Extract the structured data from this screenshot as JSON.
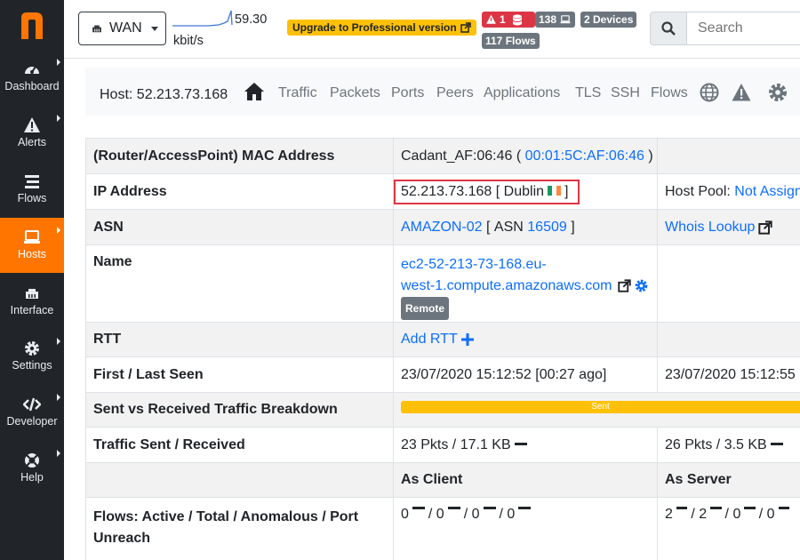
{
  "sidebar": {
    "items": [
      {
        "label": "Dashboard",
        "icon": "gauge-icon"
      },
      {
        "label": "Alerts",
        "icon": "warning-icon"
      },
      {
        "label": "Flows",
        "icon": "stream-icon"
      },
      {
        "label": "Hosts",
        "icon": "laptop-icon",
        "active": true
      },
      {
        "label": "Interface",
        "icon": "ethernet-icon"
      },
      {
        "label": "Settings",
        "icon": "cog-icon"
      },
      {
        "label": "Developer",
        "icon": "code-icon"
      },
      {
        "label": "Help",
        "icon": "life-ring-icon"
      }
    ]
  },
  "topbar": {
    "interface": "WAN",
    "throughput_value": "59.30",
    "throughput_unit": "kbit/s",
    "upgrade_label": "Upgrade to Professional version",
    "alerts_count": "1",
    "hosts_count": "138",
    "devices_label": "2 Devices",
    "flows_label": "117 Flows",
    "search_placeholder": "Search"
  },
  "hostnav": {
    "title": "Host: 52.213.73.168",
    "tabs": [
      "Traffic",
      "Packets",
      "Ports",
      "Peers",
      "Applications",
      "TLS",
      "SSH",
      "Flows"
    ]
  },
  "table": {
    "mac": {
      "label": "(Router/AccessPoint) MAC Address",
      "vendor": "Cadant_AF:06:46",
      "address": "00:01:5C:AF:06:46"
    },
    "ip": {
      "label": "IP Address",
      "value": "52.213.73.168",
      "city": "Dublin",
      "pool_label": "Host Pool:",
      "pool_value": "Not Assigned"
    },
    "asn": {
      "label": "ASN",
      "name": "AMAZON-02",
      "asn_prefix": "ASN",
      "asn_number": "16509",
      "whois": "Whois Lookup"
    },
    "name": {
      "label": "Name",
      "line1": "ec2-52-213-73-168.eu-",
      "line2": "west-1.compute.amazonaws.com",
      "badge": "Remote"
    },
    "rtt": {
      "label": "RTT",
      "action": "Add RTT"
    },
    "seen": {
      "label": "First / Last Seen",
      "first": "23/07/2020 15:12:52 [00:27 ago]",
      "last": "23/07/2020 15:12:55"
    },
    "breakdown": {
      "label": "Sent vs Received Traffic Breakdown",
      "bar_label": "Sent",
      "sent_fraction": 1.0
    },
    "traffic": {
      "label": "Traffic Sent / Received",
      "sent": "23 Pkts / 17.1 KB",
      "received": "26 Pkts / 3.5 KB"
    },
    "roles": {
      "client": "As Client",
      "server": "As Server"
    },
    "flows": {
      "label_line1": "Flows: Active / Total / Anomalous / Port",
      "label_line2": "Unreach",
      "client_values": [
        "0",
        "0",
        "0",
        "0"
      ],
      "server_values": [
        "2",
        "2",
        "0",
        "0"
      ]
    }
  },
  "colors": {
    "accent": "#ff7500",
    "sidebar": "#212529",
    "link": "#0d6efd",
    "warning": "#ffc107",
    "danger": "#dc3545"
  }
}
